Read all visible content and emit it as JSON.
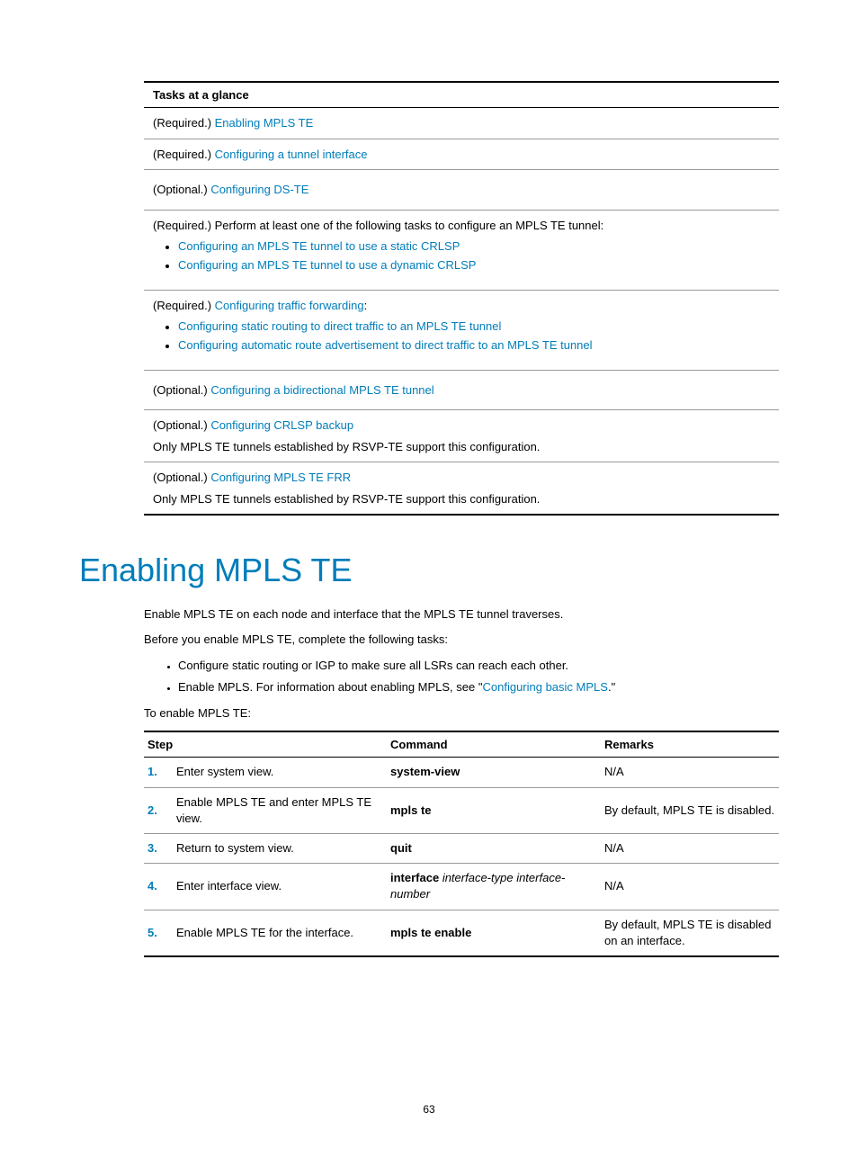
{
  "tasksTable": {
    "header": "Tasks at a glance",
    "rows": [
      {
        "prefix": "(Required.) ",
        "link": "Enabling MPLS TE"
      },
      {
        "prefix": "(Required.) ",
        "link": "Configuring a tunnel interface"
      },
      {
        "prefix": "(Optional.) ",
        "link": "Configuring DS-TE"
      },
      {
        "prefix": "(Required.) Perform at least one of the following tasks to configure an MPLS TE tunnel:",
        "bullets": [
          "Configuring an MPLS TE tunnel to use a static CRLSP",
          "Configuring an MPLS TE tunnel to use a dynamic CRLSP"
        ]
      },
      {
        "prefix": "(Required.) ",
        "link": "Configuring traffic forwarding",
        "suffix": ":",
        "bullets": [
          "Configuring static routing to direct traffic to an MPLS TE tunnel",
          "Configuring automatic route advertisement to direct traffic to an MPLS TE tunnel"
        ]
      },
      {
        "prefix": "(Optional.) ",
        "link": "Configuring a bidirectional MPLS TE tunnel"
      },
      {
        "prefix": "(Optional.) ",
        "link": "Configuring CRLSP backup",
        "note": "Only MPLS TE tunnels established by RSVP-TE support this configuration."
      },
      {
        "prefix": "(Optional.) ",
        "link": "Configuring MPLS TE FRR",
        "note": "Only MPLS TE tunnels established by RSVP-TE support this configuration."
      }
    ]
  },
  "section": {
    "title": "Enabling MPLS TE",
    "para1": "Enable MPLS TE on each node and interface that the MPLS TE tunnel traverses.",
    "para2": "Before you enable MPLS TE, complete the following tasks:",
    "bullets": [
      {
        "text": "Configure static routing or IGP to make sure all LSRs can reach each other."
      },
      {
        "textPrefix": "Enable MPLS. For information about enabling MPLS, see \"",
        "link": "Configuring basic MPLS",
        "textSuffix": ".\""
      }
    ],
    "para3": "To enable MPLS TE:"
  },
  "stepsTable": {
    "headers": {
      "step": "Step",
      "command": "Command",
      "remarks": "Remarks"
    },
    "rows": [
      {
        "num": "1.",
        "step": "Enter system view.",
        "cmdBold": "system-view",
        "remarks": "N/A"
      },
      {
        "num": "2.",
        "step": "Enable MPLS TE and enter MPLS TE view.",
        "cmdBold": "mpls te",
        "remarks": "By default, MPLS TE is disabled."
      },
      {
        "num": "3.",
        "step": "Return to system view.",
        "cmdBold": "quit",
        "remarks": "N/A"
      },
      {
        "num": "4.",
        "step": "Enter interface view.",
        "cmdBold": "interface",
        "cmdItalic": " interface-type interface-number",
        "remarks": "N/A"
      },
      {
        "num": "5.",
        "step": "Enable MPLS TE for the interface.",
        "cmdBold": "mpls te enable",
        "remarks": "By default, MPLS TE is disabled on an interface."
      }
    ]
  },
  "pageNumber": "63"
}
